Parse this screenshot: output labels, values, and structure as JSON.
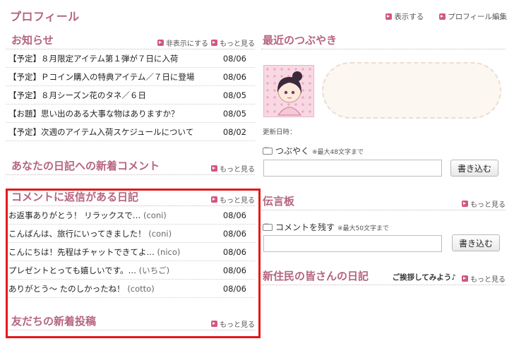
{
  "header": {
    "title": "プロフィール",
    "show_link": "表示する",
    "edit_link": "プロフィール編集"
  },
  "news": {
    "title": "お知らせ",
    "hide_link": "非表示にする",
    "more_link": "もっと見る",
    "items": [
      {
        "text": "【予定】８月限定アイテム第１弾が７日に入荷",
        "date": "08/06"
      },
      {
        "text": "【予定】Ｐコイン購入の特典アイテム／７日に登場",
        "date": "08/06"
      },
      {
        "text": "【予定】８月シーズン花のタネ／６日",
        "date": "08/05"
      },
      {
        "text": "【お題】思い出のある大事な物はありますか？",
        "date": "08/05"
      },
      {
        "text": "【予定】次週のアイテム入荷スケジュールについて",
        "date": "08/02"
      }
    ]
  },
  "diary_comments": {
    "title": "あなたの日記への新着コメント",
    "more_link": "もっと見る"
  },
  "replied_diaries": {
    "title": "コメントに返信がある日記",
    "more_link": "もっと見る",
    "items": [
      {
        "text": "お返事ありがとう！ リラックスで…",
        "user": "(coni)",
        "date": "08/06"
      },
      {
        "text": "こんばんは、旅行にいってきました！",
        "user": "(coni)",
        "date": "08/06"
      },
      {
        "text": "こんにちは！先程はチャットできてよ…",
        "user": "(nico)",
        "date": "08/06"
      },
      {
        "text": "プレゼントとっても嬉しいです。…",
        "user": "(いちご)",
        "date": "08/06"
      },
      {
        "text": "ありがとう〜 たのしかったね！",
        "user": "(cotto)",
        "date": "08/06"
      }
    ]
  },
  "friends": {
    "title": "友だちの新着投稿",
    "more_link": "もっと見る"
  },
  "tweets": {
    "title": "最近のつぶやき",
    "updated_label": "更新日時：",
    "post_label": "つぶやく",
    "post_limit": "※最大48文字まで",
    "post_button": "書き込む"
  },
  "board": {
    "title": "伝言板",
    "more_link": "もっと見る",
    "comment_label": "コメントを残す",
    "comment_limit": "※最大50文字まで",
    "post_button": "書き込む"
  },
  "residents": {
    "title": "新住民の皆さんの日記",
    "greeting": "ご挨拶してみよう♪",
    "more_link": "もっと見る"
  },
  "colors": {
    "accent": "#b5657e",
    "link_icon": "#d2577c",
    "highlight": "#e21a1a"
  }
}
